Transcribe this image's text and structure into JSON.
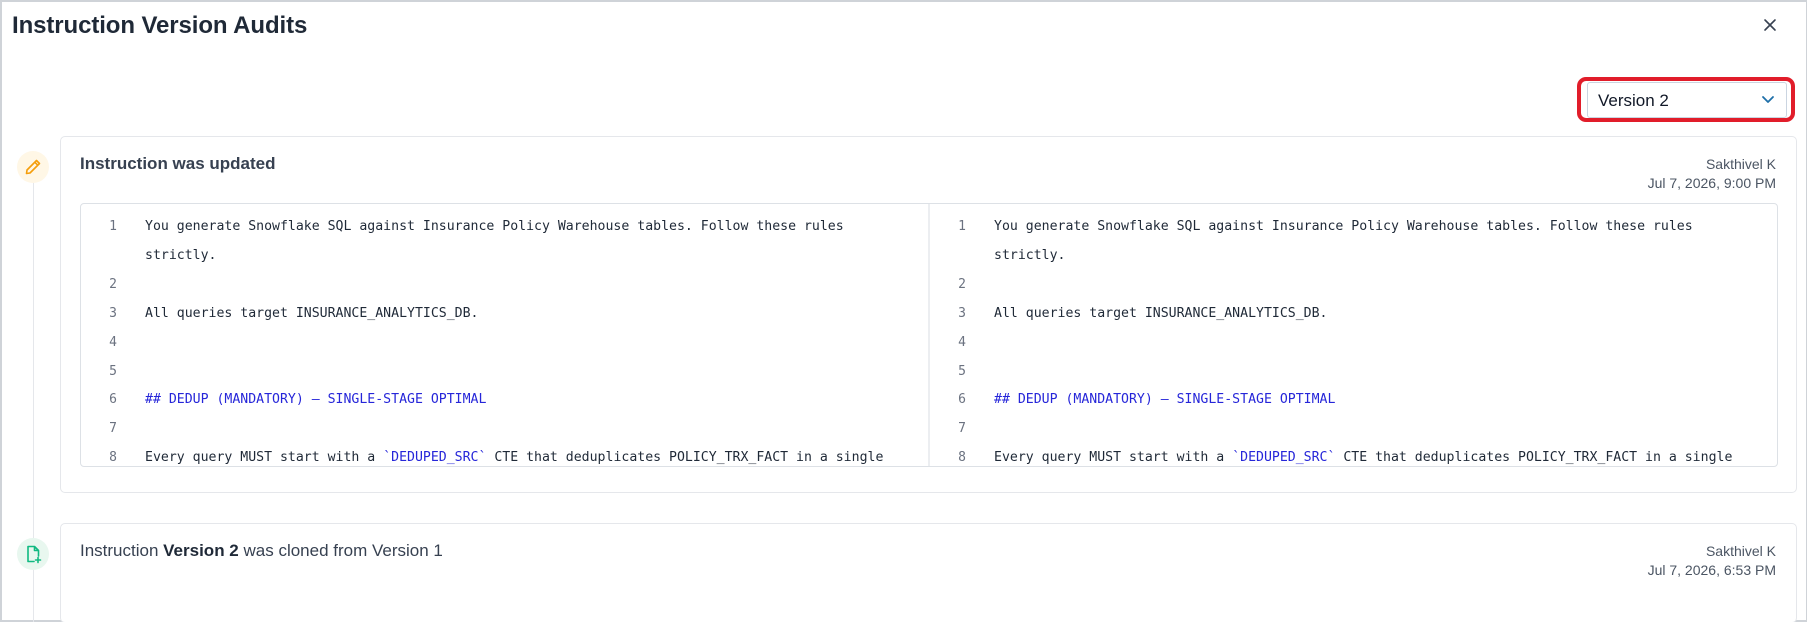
{
  "dialog": {
    "title": "Instruction Version Audits",
    "close_icon": "close-icon"
  },
  "version_select": {
    "selected": "Version 2",
    "icon": "chevron-down-icon"
  },
  "audits": [
    {
      "type": "update",
      "icon": "pencil-icon",
      "title": "Instruction was updated",
      "user": "Sakthivel K",
      "timestamp": "Jul 7, 2026, 9:00 PM",
      "diff": {
        "left": [
          {
            "n": "1",
            "text": "You generate Snowflake SQL against Insurance Policy Warehouse tables. Follow these rules strictly."
          },
          {
            "n": "2",
            "text": ""
          },
          {
            "n": "3",
            "text": "All queries target INSURANCE_ANALYTICS_DB."
          },
          {
            "n": "4",
            "text": ""
          },
          {
            "n": "5",
            "text": ""
          },
          {
            "n": "6",
            "text": "## DEDUP (MANDATORY) — SINGLE-STAGE OPTIMAL"
          },
          {
            "n": "7",
            "text": ""
          },
          {
            "n": "8",
            "pre": "Every query MUST start with a ",
            "code": "`DEDUPED_SRC`",
            "post": " CTE that deduplicates POLICY_TRX_FACT in a single"
          }
        ],
        "right": [
          {
            "n": "1",
            "text": "You generate Snowflake SQL against Insurance Policy Warehouse tables. Follow these rules strictly."
          },
          {
            "n": "2",
            "text": ""
          },
          {
            "n": "3",
            "text": "All queries target INSURANCE_ANALYTICS_DB."
          },
          {
            "n": "4",
            "text": ""
          },
          {
            "n": "5",
            "text": ""
          },
          {
            "n": "6",
            "text": "## DEDUP (MANDATORY) — SINGLE-STAGE OPTIMAL"
          },
          {
            "n": "7",
            "text": ""
          },
          {
            "n": "8",
            "pre": "Every query MUST start with a ",
            "code": "`DEDUPED_SRC`",
            "post": " CTE that deduplicates POLICY_TRX_FACT in a single"
          }
        ]
      }
    },
    {
      "type": "clone",
      "icon": "file-plus-icon",
      "prefix": "Instruction ",
      "version": "Version 2",
      "suffix": " was cloned from Version 1",
      "user": "Sakthivel K",
      "timestamp": "Jul 7, 2026, 6:53 PM"
    }
  ],
  "colors": {
    "highlight": "#e11d2a",
    "heading_blue": "#2626d9",
    "edit_icon": "#f59e0b",
    "clone_icon": "#10b981"
  }
}
